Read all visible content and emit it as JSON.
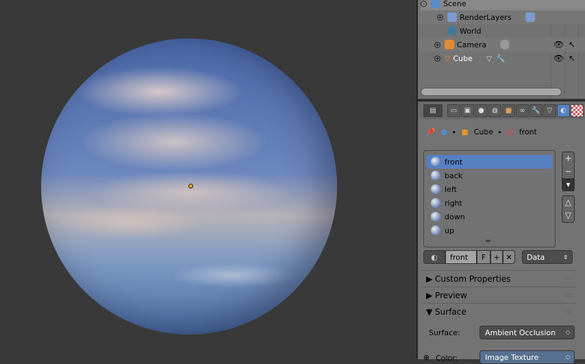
{
  "outliner": {
    "rows": [
      {
        "label": "Scene",
        "expander": "-"
      },
      {
        "label": "RenderLayers",
        "expander": "+"
      },
      {
        "label": "World",
        "expander": ""
      },
      {
        "label": "Camera",
        "expander": "+"
      },
      {
        "label": "Cube",
        "expander": "+"
      }
    ]
  },
  "properties": {
    "tabs": [
      "render-icon",
      "render-layers-icon",
      "scene-icon",
      "world-icon",
      "object-icon",
      "constraints-icon",
      "modifiers-icon",
      "data-icon",
      "material-icon",
      "texture-icon"
    ],
    "breadcrumb": {
      "object": "Cube",
      "material": "front"
    },
    "slots": [
      "front",
      "back",
      "left",
      "right",
      "down",
      "up"
    ],
    "active_slot": "front",
    "material_name": "front",
    "fake_user": "F",
    "link": "Data",
    "panels": [
      "Custom Properties",
      "Preview",
      "Surface"
    ],
    "surface_label": "Surface:",
    "surface_value": "Ambient Occlusion",
    "color_label": "Color:",
    "color_value": "Image Texture"
  },
  "colors": {
    "accent": "#5680c2",
    "viewport_bg": "#393939"
  }
}
